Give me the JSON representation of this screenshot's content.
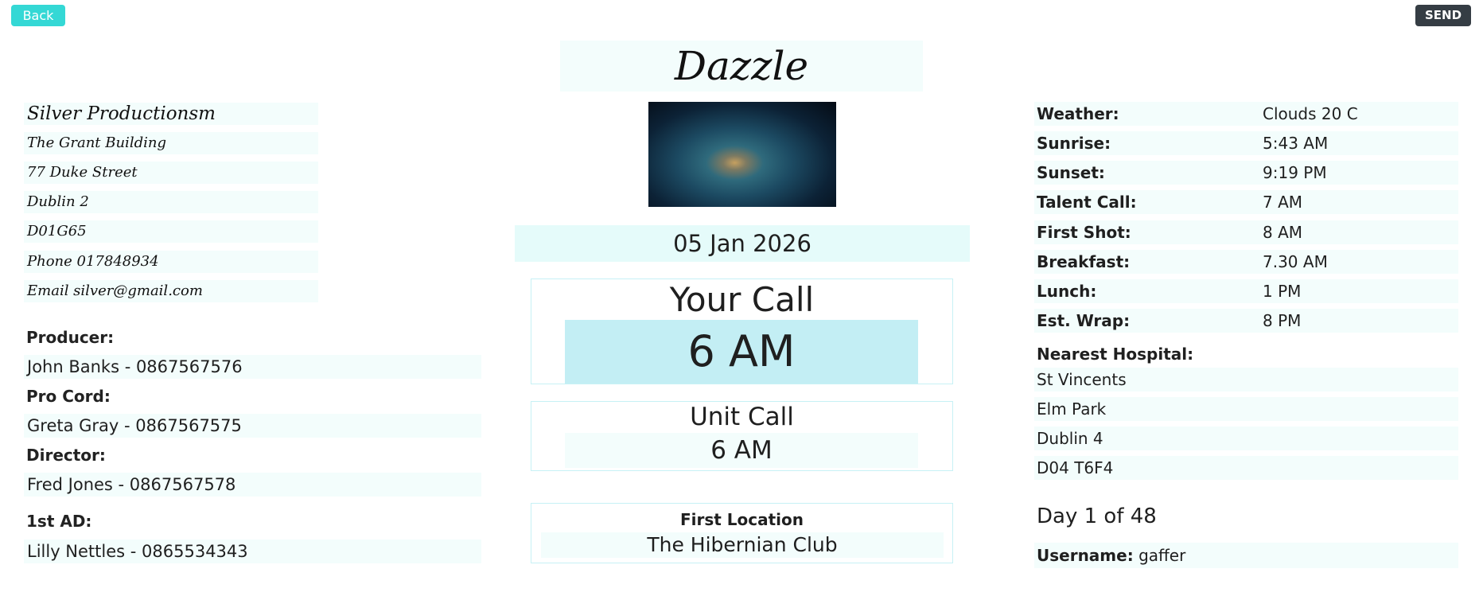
{
  "toolbar": {
    "back_label": "Back",
    "send_label": "SEND"
  },
  "production": {
    "title": "Dazzle"
  },
  "company": {
    "lines": [
      "Silver Productionsm",
      "The Grant Building",
      "77 Duke Street",
      "Dublin 2",
      "D01G65",
      "Phone 017848934",
      "Email silver@gmail.com"
    ]
  },
  "crew": [
    {
      "role": "Producer:",
      "contact": "John Banks - 0867567576"
    },
    {
      "role": "Pro Cord:",
      "contact": "Greta Gray - 0867567575"
    },
    {
      "role": "Director:",
      "contact": "Fred Jones - 0867567578"
    },
    {
      "role": "1st AD:",
      "contact": "Lilly Nettles - 0865534343"
    }
  ],
  "schedule": {
    "date": "05 Jan 2026",
    "your_call_title": "Your Call",
    "your_call_time": "6 AM",
    "unit_call_title": "Unit Call",
    "unit_call_time": "6 AM",
    "first_location_label": "First Location",
    "first_location_value": "The Hibernian Club"
  },
  "info": [
    {
      "label": "Weather:",
      "value": "Clouds 20 C"
    },
    {
      "label": "Sunrise:",
      "value": "5:43 AM"
    },
    {
      "label": "Sunset:",
      "value": "9:19 PM"
    },
    {
      "label": "Talent Call:",
      "value": "7 AM"
    },
    {
      "label": "First Shot:",
      "value": "8 AM"
    },
    {
      "label": "Breakfast:",
      "value": "7.30 AM"
    },
    {
      "label": "Lunch:",
      "value": "1 PM"
    },
    {
      "label": "Est. Wrap:",
      "value": "8 PM"
    }
  ],
  "hospital": {
    "label": "Nearest Hospital:",
    "lines": [
      "St Vincents",
      "Elm Park",
      "Dublin 4",
      "D04 T6F4"
    ]
  },
  "day_counter": "Day 1 of 48",
  "user": {
    "label": "Username:",
    "value": "gaffer"
  },
  "colors": {
    "back_button": "#34d8d5",
    "send_button": "#353d44",
    "your_call_highlight": "#c3eef4",
    "row_tint": "#f3fdfc",
    "card_border": "#c7f1f5"
  }
}
